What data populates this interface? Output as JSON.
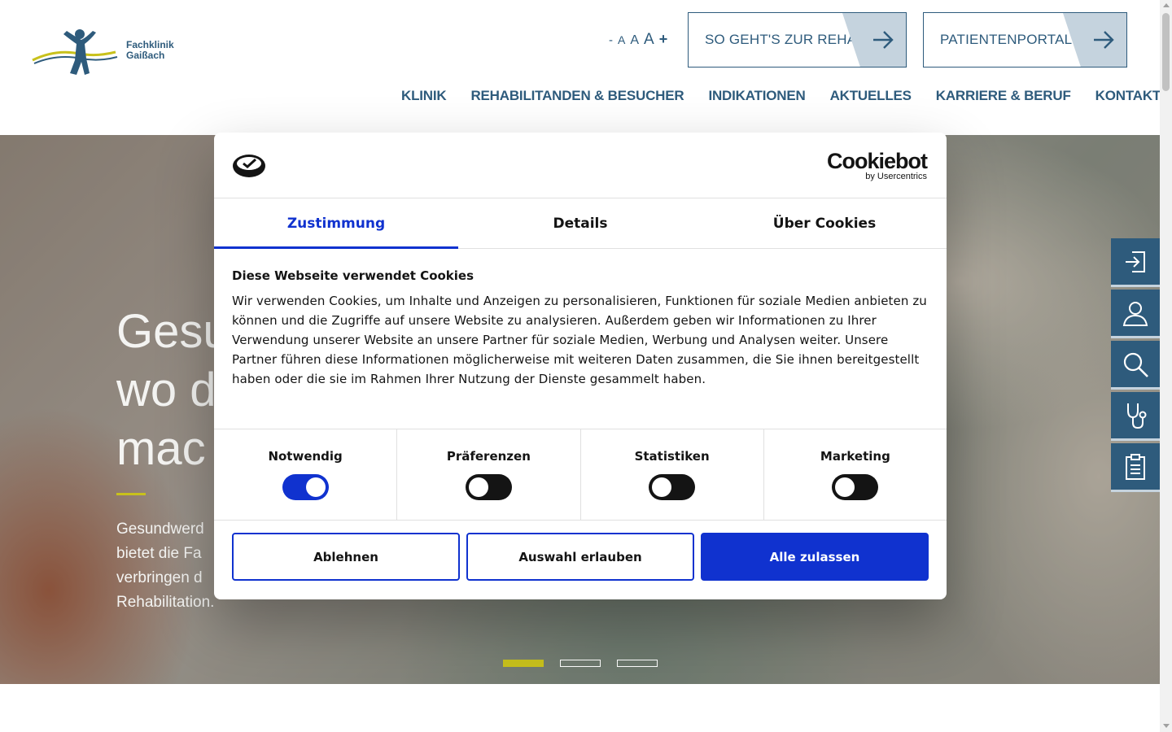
{
  "header": {
    "logo_text_line1": "Fachklinik",
    "logo_text_line2": "Gaißach",
    "font_size_controls": {
      "minus": "-",
      "a_small": "A",
      "a_medium": "A",
      "a_large": "A",
      "plus": "+"
    },
    "cta_primary": "SO GEHT'S ZUR REHA",
    "cta_secondary": "PATIENTENPORTAL",
    "nav": [
      "KLINIK",
      "REHABILITANDEN & BESUCHER",
      "INDIKATIONEN",
      "AKTUELLES",
      "KARRIERE & BERUF",
      "KONTAKT"
    ]
  },
  "hero": {
    "headline": "Gesu\nwo d\nmac",
    "text": "Gesundwerd\nbietet die Fa\nverbringen d\nRehabilitation.",
    "slides": 3,
    "active_slide": 1
  },
  "side_toolbar": {
    "icons": [
      "login-icon",
      "user-icon",
      "search-icon",
      "stethoscope-icon",
      "clipboard-icon"
    ]
  },
  "cookie": {
    "brand": "Cookiebot",
    "brand_sub": "by Usercentrics",
    "tabs": [
      "Zustimmung",
      "Details",
      "Über Cookies"
    ],
    "active_tab": "Zustimmung",
    "title": "Diese Webseite verwendet Cookies",
    "body": "Wir verwenden Cookies, um Inhalte und Anzeigen zu personalisieren, Funktionen für soziale Medien anbieten zu können und die Zugriffe auf unsere Website zu analysieren. Außerdem geben wir Informationen zu Ihrer Verwendung unserer Website an unsere Partner für soziale Medien, Werbung und Analysen weiter. Unsere Partner führen diese Informationen möglicherweise mit weiteren Daten zusammen, die Sie ihnen bereitgestellt haben oder die sie im Rahmen Ihrer Nutzung der Dienste gesammelt haben.",
    "categories": [
      {
        "label": "Notwendig",
        "on": true
      },
      {
        "label": "Präferenzen",
        "on": false
      },
      {
        "label": "Statistiken",
        "on": false
      },
      {
        "label": "Marketing",
        "on": false
      }
    ],
    "buttons": {
      "reject": "Ablehnen",
      "allow_selection": "Auswahl erlauben",
      "allow_all": "Alle zulassen"
    }
  },
  "colors": {
    "brand_blue": "#2e5b7c",
    "brand_yellow": "#c8c11c",
    "cookiebot_blue": "#1032cf"
  }
}
